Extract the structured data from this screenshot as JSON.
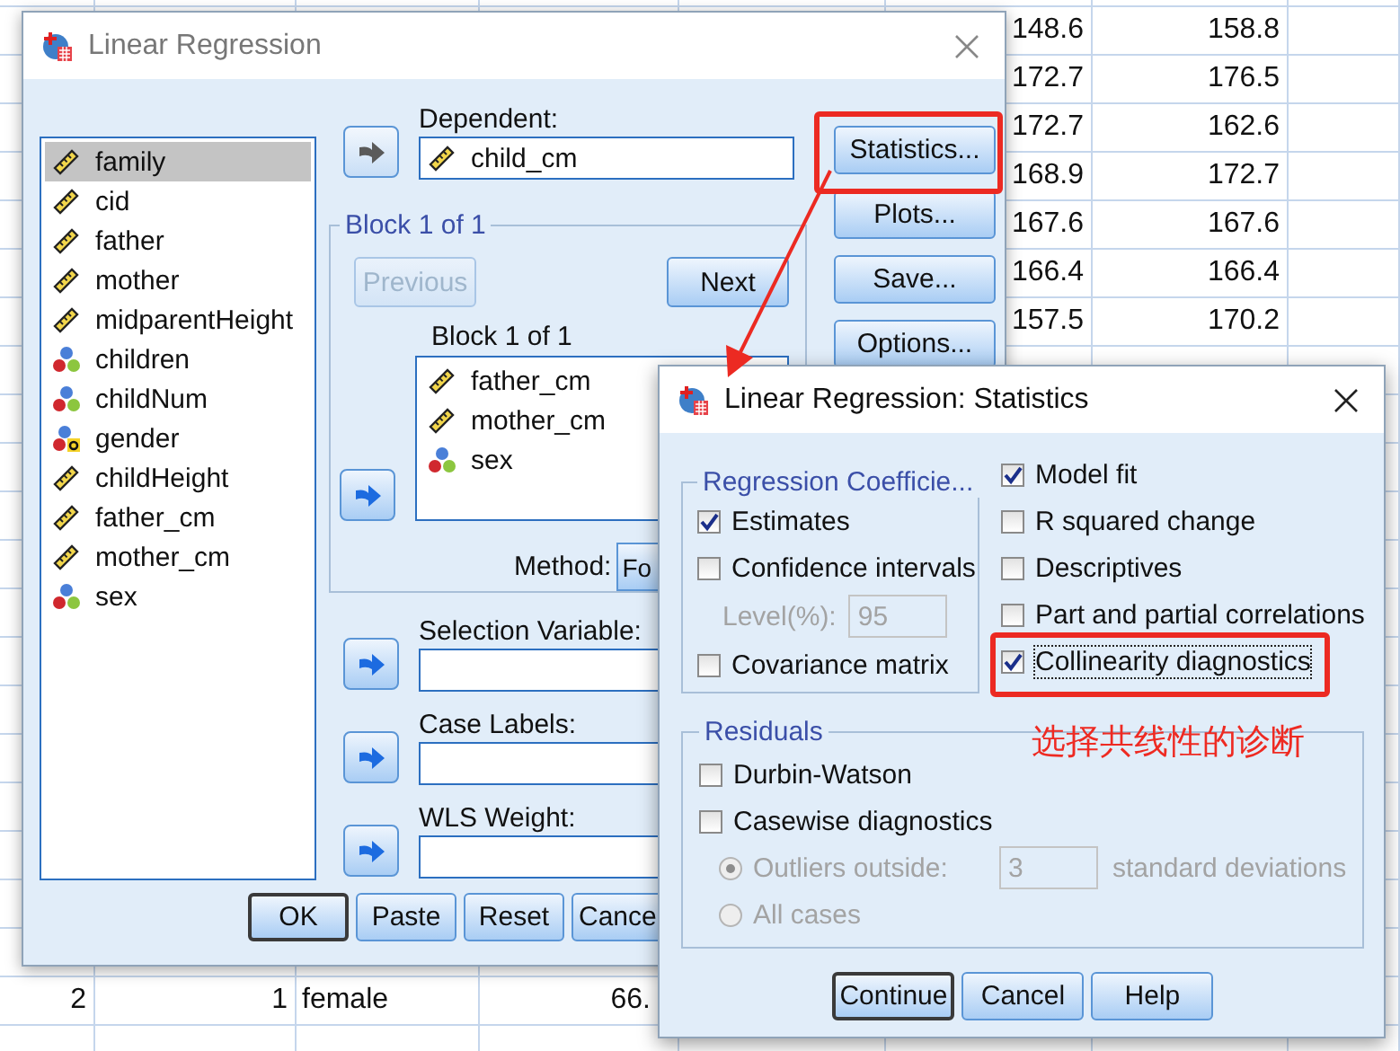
{
  "spreadsheet": {
    "top_rows": [
      {
        "column_6": "148.6",
        "column_7": "158.8"
      },
      {
        "column_6": "172.7",
        "column_7": "176.5"
      },
      {
        "column_6": "172.7",
        "column_7": "162.6"
      },
      {
        "column_6": "168.9",
        "column_7": "172.7"
      },
      {
        "column_6": "167.6",
        "column_7": "167.6"
      },
      {
        "column_6": "166.4",
        "column_7": "166.4"
      },
      {
        "column_6": "157.5",
        "column_7": "170.2"
      }
    ],
    "bottom_row": {
      "column_1": "2",
      "column_2": "1",
      "column_3": "female",
      "column_4": "66."
    }
  },
  "main_dialog": {
    "title": "Linear Regression",
    "active": false,
    "variables": [
      {
        "name": "family",
        "kind": "scale",
        "selected": true
      },
      {
        "name": "cid",
        "kind": "scale",
        "selected": false
      },
      {
        "name": "father",
        "kind": "scale",
        "selected": false
      },
      {
        "name": "mother",
        "kind": "scale",
        "selected": false
      },
      {
        "name": "midparentHeight",
        "kind": "scale",
        "selected": false
      },
      {
        "name": "children",
        "kind": "nominal",
        "selected": false
      },
      {
        "name": "childNum",
        "kind": "nominal",
        "selected": false
      },
      {
        "name": "gender",
        "kind": "string",
        "selected": false
      },
      {
        "name": "childHeight",
        "kind": "scale",
        "selected": false
      },
      {
        "name": "father_cm",
        "kind": "scale",
        "selected": false
      },
      {
        "name": "mother_cm",
        "kind": "scale",
        "selected": false
      },
      {
        "name": "sex",
        "kind": "nominal",
        "selected": false
      }
    ],
    "dependent": {
      "label": "Dependent:",
      "arrow_disabled": true,
      "items": [
        {
          "name": "child_cm",
          "kind": "scale"
        }
      ]
    },
    "block": {
      "legend": "Block 1 of 1",
      "previous": {
        "label": "Previous",
        "disabled": true
      },
      "next": {
        "label": "Next",
        "disabled": false
      },
      "label": "Block 1 of 1",
      "arrow_disabled": false,
      "independents": [
        {
          "name": "father_cm",
          "kind": "scale"
        },
        {
          "name": "mother_cm",
          "kind": "scale"
        },
        {
          "name": "sex",
          "kind": "nominal"
        }
      ]
    },
    "method": {
      "label": "Method:",
      "value": "Fo"
    },
    "targets": [
      {
        "label": "Selection Variable:",
        "arrow_disabled": false
      },
      {
        "label": "Case Labels:",
        "arrow_disabled": false
      },
      {
        "label": "WLS Weight:",
        "arrow_disabled": false
      }
    ],
    "side_buttons": [
      {
        "label": "Statistics..."
      },
      {
        "label": "Plots..."
      },
      {
        "label": "Save..."
      },
      {
        "label": "Options..."
      }
    ],
    "buttons": [
      {
        "label": "OK",
        "default": true
      },
      {
        "label": "Paste",
        "default": false
      },
      {
        "label": "Reset",
        "default": false
      },
      {
        "label": "Cance",
        "default": false
      }
    ]
  },
  "statistics_dialog": {
    "title": "Linear Regression: Statistics",
    "active": true,
    "coefficients": {
      "legend": "Regression Coefficie...",
      "options": [
        {
          "kind": "check",
          "label": "Estimates",
          "checked": true
        },
        {
          "kind": "check",
          "label": "Confidence intervals",
          "checked": false
        },
        {
          "kind": "level",
          "label": "Level(%):",
          "value": "95",
          "disabled": true
        },
        {
          "kind": "check",
          "label": "Covariance matrix",
          "checked": false
        }
      ]
    },
    "other_options": [
      {
        "label": "Model fit",
        "checked": true,
        "focused": false
      },
      {
        "label": "R squared change",
        "checked": false,
        "focused": false
      },
      {
        "label": "Descriptives",
        "checked": false,
        "focused": false
      },
      {
        "label": "Part and partial correlations",
        "checked": false,
        "focused": false
      },
      {
        "label": "Collinearity diagnostics",
        "checked": true,
        "focused": true
      }
    ],
    "residuals": {
      "legend": "Residuals",
      "options": [
        {
          "kind": "check",
          "label": "Durbin-Watson",
          "checked": false
        },
        {
          "kind": "check",
          "label": "Casewise diagnostics",
          "checked": false
        },
        {
          "kind": "radio",
          "label": "Outliers outside:",
          "selected": true,
          "disabled": true,
          "value": "3",
          "suffix": "standard deviations"
        },
        {
          "kind": "radio",
          "label": "All cases",
          "selected": false,
          "disabled": true
        }
      ]
    },
    "buttons": [
      {
        "label": "Continue",
        "default": true
      },
      {
        "label": "Cancel",
        "default": false
      },
      {
        "label": "Help",
        "default": false
      }
    ]
  },
  "annotation": {
    "note": "选择共线性的诊断"
  }
}
